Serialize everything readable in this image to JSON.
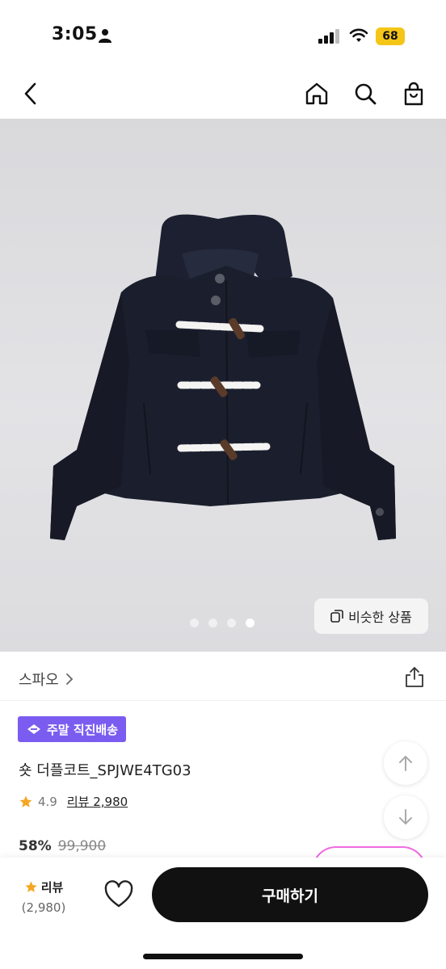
{
  "status_bar": {
    "time": "3:05",
    "battery": "68"
  },
  "top_nav": {
    "icons": [
      "back-icon",
      "home-icon",
      "search-icon",
      "shopping-bag-icon"
    ]
  },
  "gallery": {
    "similar_label": "비슷한 상품",
    "page_count": 4,
    "active_page": 4
  },
  "brand": {
    "name": "스파오"
  },
  "product": {
    "badge": "주말 직진배송",
    "title": "숏 더플코트_SPJWE4TG03",
    "rating": "4.9",
    "review_link": "리뷰 2,980",
    "discount": "58%",
    "original_price": "99,900"
  },
  "bottom_bar": {
    "review_label": "리뷰",
    "review_count": "(2,980)",
    "buy_label": "구매하기"
  },
  "colors": {
    "accent_purple": "#7b5cf0",
    "star": "#f5a623",
    "buy_button": "#111111"
  }
}
